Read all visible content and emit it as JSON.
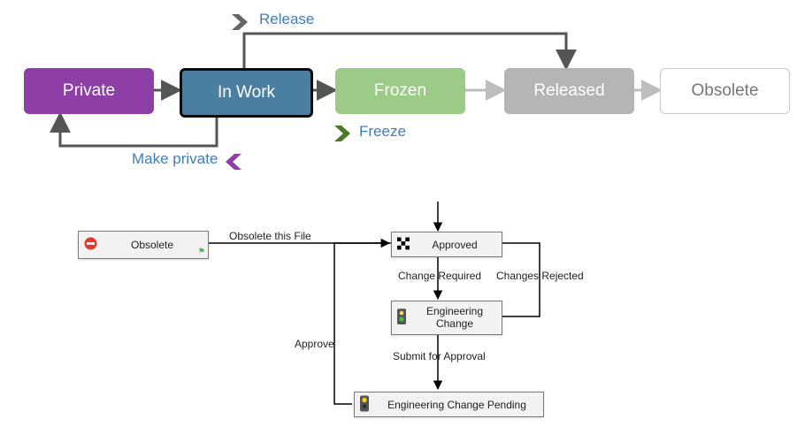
{
  "top_workflow": {
    "states": {
      "private": "Private",
      "in_work": "In Work",
      "frozen": "Frozen",
      "released": "Released",
      "obsolete": "Obsolete"
    },
    "actions": {
      "release": "Release",
      "freeze": "Freeze",
      "make_private": "Make private"
    },
    "colors": {
      "private": "#8e3fa7",
      "in_work": "#4a7fa1",
      "in_work_border": "#0d0d0d",
      "frozen": "#9bcb86",
      "released": "#b5b5b5",
      "obsolete_border": "#c8c8c8",
      "action_label": "#3d7fbc",
      "release_chevron": "#666666",
      "freeze_chevron": "#4a7a29",
      "private_chevron": "#8e3fa7"
    }
  },
  "lower_workflow": {
    "nodes": {
      "obsolete": "Obsolete",
      "approved": "Approved",
      "engineering_change": "Engineering\nChange",
      "engineering_change_pending": "Engineering Change Pending"
    },
    "transitions": {
      "obsolete_this_file": "Obsolete this File",
      "change_required": "Change Required",
      "changes_rejected": "Changes Rejected",
      "approve": "Approve",
      "submit_for_approval": "Submit for Approval"
    }
  }
}
